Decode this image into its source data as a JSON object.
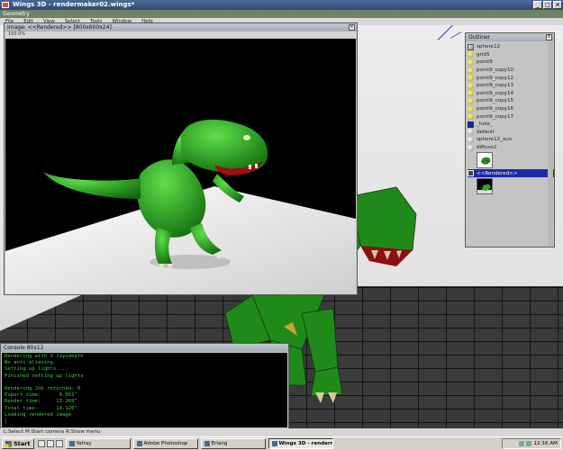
{
  "app": {
    "title": "Wings 3D - rendermaker02.wings*",
    "window_buttons": [
      "_",
      "□",
      "×"
    ]
  },
  "geometry_bar": {
    "label": "Geometry"
  },
  "menu": {
    "items": [
      "File",
      "Edit",
      "View",
      "Select",
      "Tools",
      "Window",
      "Help"
    ]
  },
  "image_window": {
    "title": "Image: <<Rendered>> [800x600x24]",
    "zoom": "100.0%",
    "close": "×"
  },
  "outliner": {
    "title": "Outliner",
    "close": "×",
    "items": [
      {
        "label": "sphere12",
        "icon": "object-icon"
      },
      {
        "label": "grid5",
        "icon": "light-icon"
      },
      {
        "label": "point9",
        "icon": "light-icon"
      },
      {
        "label": "point9_copy10",
        "icon": "light-icon"
      },
      {
        "label": "point9_copy12",
        "icon": "light-icon"
      },
      {
        "label": "point9_copy13",
        "icon": "light-icon"
      },
      {
        "label": "point9_copy14",
        "icon": "light-icon"
      },
      {
        "label": "point9_copy15",
        "icon": "light-icon"
      },
      {
        "label": "point9_copy16",
        "icon": "light-icon"
      },
      {
        "label": "point9_copy17",
        "icon": "light-icon"
      },
      {
        "label": "_hole_",
        "icon": "hole-icon"
      },
      {
        "label": "default",
        "icon": "material-icon"
      },
      {
        "label": "sphere12_auv",
        "icon": "material-icon"
      },
      {
        "label": "diffuse2",
        "icon": "material-icon"
      }
    ],
    "selected_item": "<<Rendered>>"
  },
  "console": {
    "title": "Console 80x12",
    "lines": [
      "Rendering with 3 raysdepth",
      "No anti-aliasing.",
      "Setting up lights ...",
      "Finished setting up lights",
      "",
      "Rendering Job returned: 0",
      "Export time:      0.051\"",
      "Render time:     13.269\"",
      "Total time:      14.120\"",
      "Loading rendered image"
    ],
    "cursor": "|"
  },
  "status": {
    "text": "L:Select   M:Start camera   R:Show menu"
  },
  "taskbar": {
    "start_label": "Start",
    "tasks": [
      {
        "label": "Yafray",
        "active": false
      },
      {
        "label": "Adobe Photoshop",
        "active": false
      },
      {
        "label": "Erlang",
        "active": false
      },
      {
        "label": "Wings 3D - renderma...",
        "active": true
      }
    ],
    "clock": "12:16 AM"
  },
  "colors": {
    "title_bar": "#2e4a73",
    "geometry_bar": "#6b8565",
    "console_text": "#33d33a",
    "selection": "#1c2aa8",
    "dino_green": "#1f8a1a"
  }
}
